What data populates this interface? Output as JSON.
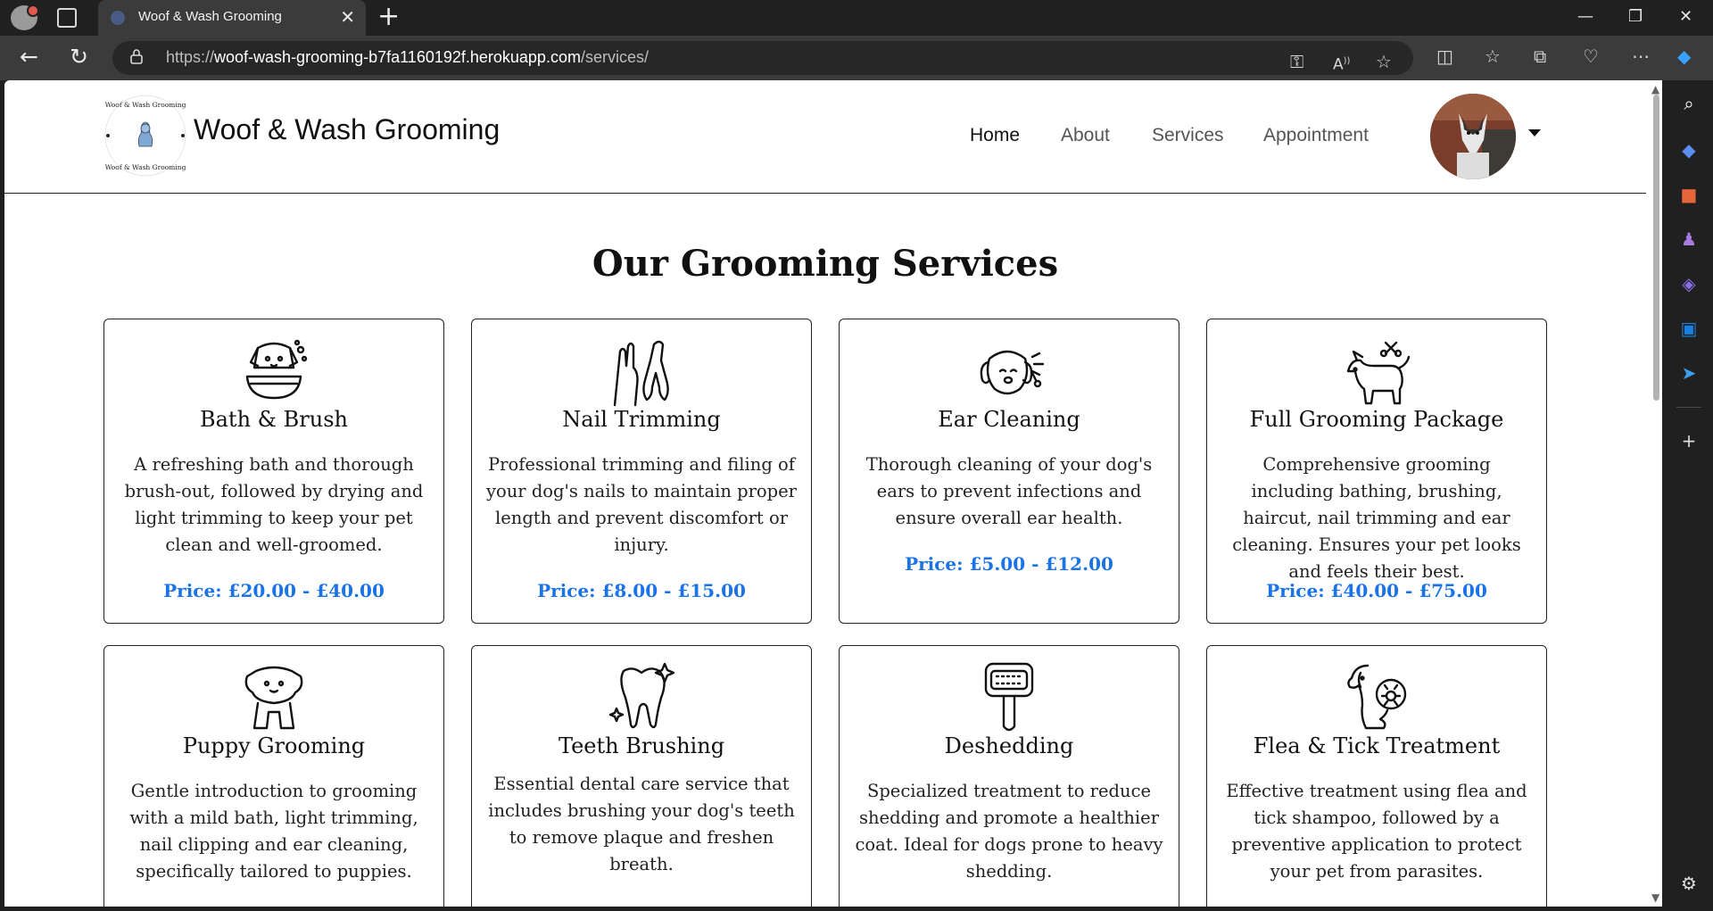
{
  "browser": {
    "tab_title": "Woof & Wash Grooming",
    "url_scheme": "https://",
    "url_host": "woof-wash-grooming-b7fa1160192f.herokuapp.com",
    "url_path": "/services/"
  },
  "site": {
    "brand": "Woof & Wash Grooming",
    "logo_text": "Woof & Wash Grooming",
    "nav": [
      "Home",
      "About",
      "Services",
      "Appointment"
    ]
  },
  "page": {
    "title": "Our Grooming Services",
    "services": [
      {
        "title": "Bath & Brush",
        "desc": "A refreshing bath and thorough brush-out, followed by drying and light trimming to keep your pet clean and well-groomed.",
        "price": "Price: £20.00 - £40.00"
      },
      {
        "title": "Nail Trimming",
        "desc": "Professional trimming and filing of your dog's nails to maintain proper length and prevent discomfort or injury.",
        "price": "Price: £8.00 - £15.00"
      },
      {
        "title": "Ear Cleaning",
        "desc": "Thorough cleaning of your dog's ears to prevent infections and ensure overall ear health.",
        "price": "Price: £5.00 - £12.00"
      },
      {
        "title": "Full Grooming Package",
        "desc": "Comprehensive grooming including bathing, brushing, haircut, nail trimming and ear cleaning. Ensures your pet looks and feels their best.",
        "price": "Price: £40.00 - £75.00"
      },
      {
        "title": "Puppy Grooming",
        "desc": "Gentle introduction to grooming with a mild bath, light trimming, nail clipping and ear cleaning, specifically tailored to puppies.",
        "price": ""
      },
      {
        "title": "Teeth Brushing",
        "desc": "Essential dental care service that includes brushing your dog's teeth to remove plaque and freshen breath.",
        "price": ""
      },
      {
        "title": "Deshedding",
        "desc": "Specialized treatment to reduce shedding and promote a healthier coat. Ideal for dogs prone to heavy shedding.",
        "price": ""
      },
      {
        "title": "Flea & Tick Treatment",
        "desc": "Effective treatment using flea and tick shampoo, followed by a preventive application to protect your pet from parasites.",
        "price": ""
      }
    ]
  },
  "colors": {
    "price": "#1a73e8",
    "browser_bg": "#202020"
  }
}
